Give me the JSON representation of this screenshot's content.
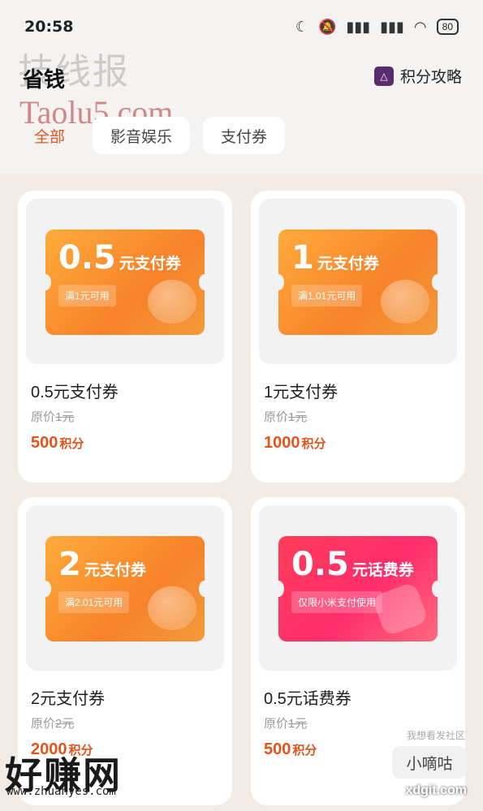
{
  "status": {
    "time": "20:58",
    "battery": "80"
  },
  "watermarks": {
    "top": "技线报",
    "taolu": "Taolu5.com",
    "bottom": "好赚网",
    "bottom_url": "www.zhuanyes.com",
    "right_top": "我想看发社区",
    "right_box": "小嘀咕",
    "right_url": "xdgit.com"
  },
  "header": {
    "title": "省钱",
    "guide_label": "积分攻略"
  },
  "tabs": [
    {
      "label": "全部"
    },
    {
      "label": "影音娱乐"
    },
    {
      "label": "支付券"
    }
  ],
  "cards": [
    {
      "coupon_amount": "0.5",
      "coupon_unit": "元支付券",
      "coupon_condition": "满1元可用",
      "name": "0.5元支付券",
      "orig_prefix": "原价",
      "orig_value": "1元",
      "points": "500",
      "points_unit": "积分",
      "color": "orange"
    },
    {
      "coupon_amount": "1",
      "coupon_unit": "元支付券",
      "coupon_condition": "满1.01元可用",
      "name": "1元支付券",
      "orig_prefix": "原价",
      "orig_value": "1元",
      "points": "1000",
      "points_unit": "积分",
      "color": "orange"
    },
    {
      "coupon_amount": "2",
      "coupon_unit": "元支付券",
      "coupon_condition": "满2.01元可用",
      "name": "2元支付券",
      "orig_prefix": "原价",
      "orig_value": "2元",
      "points": "2000",
      "points_unit": "积分",
      "color": "orange"
    },
    {
      "coupon_amount": "0.5",
      "coupon_unit": "元话费券",
      "coupon_condition": "仅限小米支付使用",
      "name": "0.5元话费券",
      "orig_prefix": "原价",
      "orig_value": "1元",
      "points": "500",
      "points_unit": "积分",
      "color": "red"
    }
  ],
  "colors": {
    "accent": "#e2541c",
    "coupon_orange": "#f7822a",
    "coupon_red": "#ff2d6c"
  }
}
